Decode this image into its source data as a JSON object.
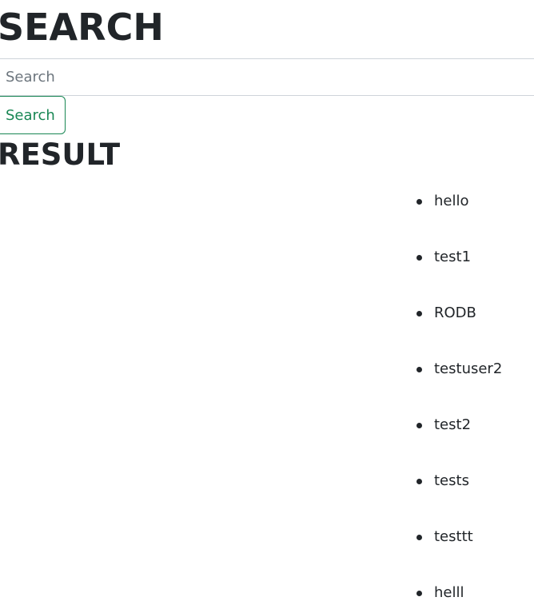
{
  "header": {
    "title": "SEARCH"
  },
  "search": {
    "placeholder": "Search",
    "value": "",
    "button_label": "Search"
  },
  "results": {
    "title": "RESULT",
    "items": [
      "hello",
      "test1",
      "RODB",
      "testuser2",
      "test2",
      "tests",
      "testtt",
      "helll"
    ]
  },
  "colors": {
    "text": "#212529",
    "placeholder": "#6c757d",
    "button_accent": "#198754",
    "border": "#ced4da"
  }
}
